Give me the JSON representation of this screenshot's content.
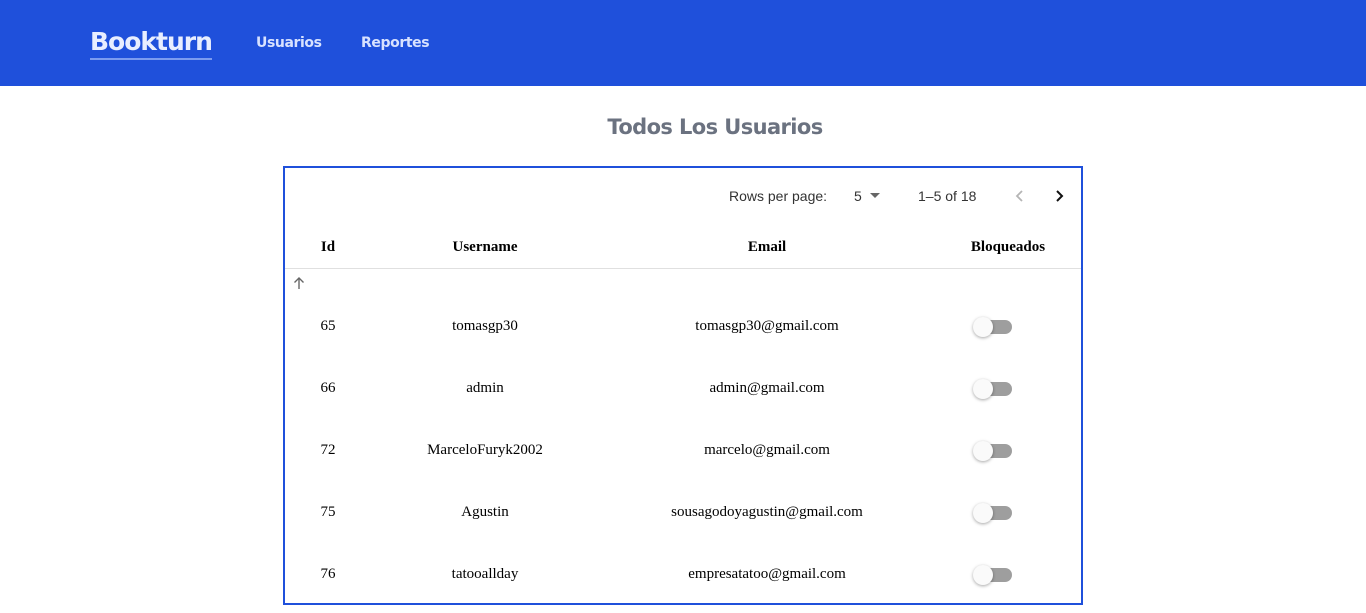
{
  "navbar": {
    "brand": "Bookturn",
    "links": [
      "Usuarios",
      "Reportes"
    ],
    "background": "#1f50db"
  },
  "page": {
    "title": "Todos Los Usuarios"
  },
  "pagination": {
    "rows_per_page_label": "Rows per page:",
    "rows_per_page_value": "5",
    "range": "1–5 of 18",
    "prev_icon": "chevron-left-icon",
    "next_icon": "chevron-right-icon"
  },
  "table": {
    "columns": [
      "Id",
      "Username",
      "Email",
      "Bloqueados"
    ],
    "sort_icon": "arrow-up-icon",
    "rows": [
      {
        "id": "65",
        "username": "tomasgp30",
        "email": "tomasgp30@gmail.com",
        "blocked": false
      },
      {
        "id": "66",
        "username": "admin",
        "email": "admin@gmail.com",
        "blocked": false
      },
      {
        "id": "72",
        "username": "MarceloFuryk2002",
        "email": "marcelo@gmail.com",
        "blocked": false
      },
      {
        "id": "75",
        "username": "Agustin",
        "email": "sousagodoyagustin@gmail.com",
        "blocked": false
      },
      {
        "id": "76",
        "username": "tatooallday",
        "email": "empresatatoo@gmail.com",
        "blocked": false
      }
    ]
  }
}
